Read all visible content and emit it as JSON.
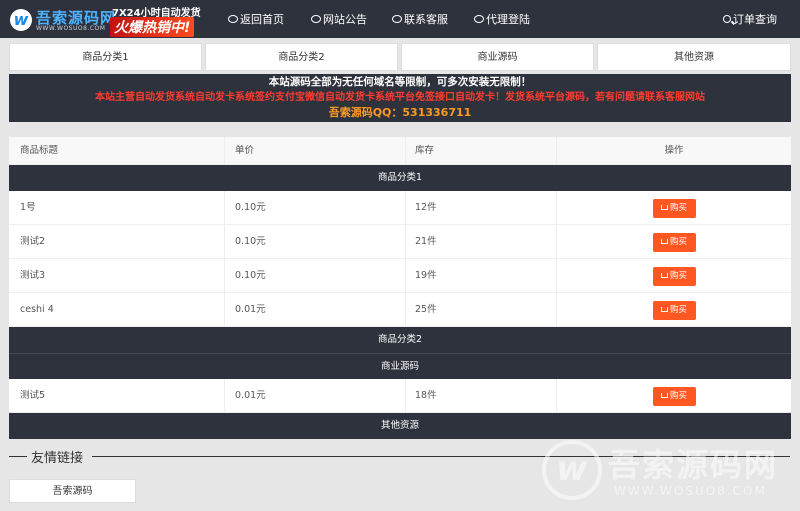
{
  "logo": {
    "mark": "w",
    "name": "吾索源码网",
    "url": "WWW.WOSUO8.COM",
    "promo_line1": "7X24小时自动发货",
    "promo_line2": "火爆热销中!"
  },
  "nav": {
    "items": [
      {
        "label": "返回首页",
        "icon": "home-icon"
      },
      {
        "label": "网站公告",
        "icon": "notice-icon"
      },
      {
        "label": "联系客服",
        "icon": "service-icon"
      },
      {
        "label": "代理登陆",
        "icon": "agent-icon"
      }
    ],
    "search_label": "订单查询"
  },
  "tabs": [
    "商品分类1",
    "商品分类2",
    "商业源码",
    "其他资源"
  ],
  "notice": {
    "line1": "本站源码全部为无任何域名等限制，可多次安装无限制！",
    "line2": "本站主营自动发货系统自动发卡系统签约支付宝微信自动发货卡系统平台免签接口自动发卡！发货系统平台源码，若有问题请联系客服网站",
    "line3": "吾索源码QQ：531336711"
  },
  "table": {
    "headers": [
      "商品标题",
      "单价",
      "库存",
      "操作"
    ],
    "buy_label": "购买",
    "groups": [
      {
        "category": "商品分类1",
        "rows": [
          {
            "title": "1号",
            "price": "0.10元",
            "stock": "12件"
          },
          {
            "title": "测试2",
            "price": "0.10元",
            "stock": "21件"
          },
          {
            "title": "测试3",
            "price": "0.10元",
            "stock": "19件"
          },
          {
            "title": "ceshi 4",
            "price": "0.01元",
            "stock": "25件"
          }
        ]
      },
      {
        "category": "商品分类2",
        "rows": []
      },
      {
        "category": "商业源码",
        "rows": [
          {
            "title": "测试5",
            "price": "0.01元",
            "stock": "18件"
          }
        ]
      },
      {
        "category": "其他资源",
        "rows": []
      }
    ]
  },
  "friend_links": {
    "title": "友情链接",
    "items": [
      "吾索源码"
    ]
  },
  "watermark": {
    "mark": "w",
    "name": "吾索源码网",
    "url": "WWW.WOSUO8.COM"
  },
  "colors": {
    "header_bg": "#2e323d",
    "buy_button": "#ff5722",
    "notice_red": "#ff3b2f",
    "notice_orange": "#ff9a1f"
  }
}
